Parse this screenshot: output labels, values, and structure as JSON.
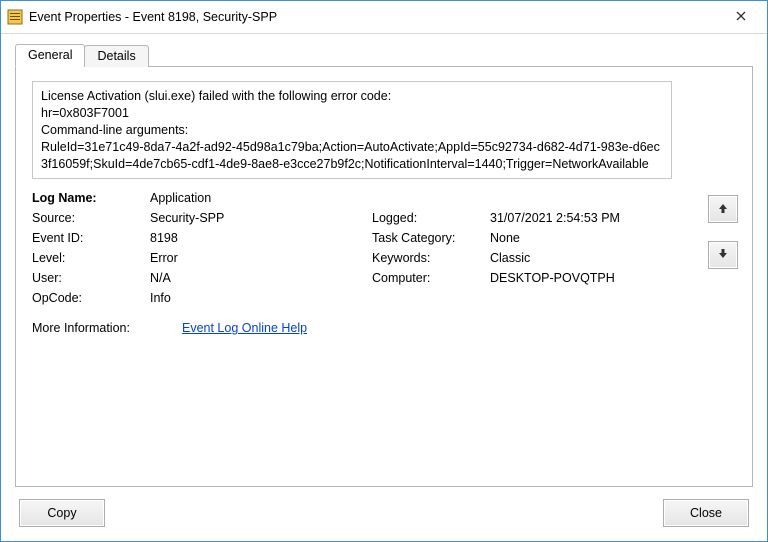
{
  "window": {
    "title": "Event Properties - Event 8198, Security-SPP"
  },
  "tabs": {
    "general": "General",
    "details": "Details"
  },
  "description": "License Activation (slui.exe) failed with the following error code:\nhr=0x803F7001\nCommand-line arguments:\nRuleId=31e71c49-8da7-4a2f-ad92-45d98a1c79ba;Action=AutoActivate;AppId=55c92734-d682-4d71-983e-d6ec3f16059f;SkuId=4de7cb65-cdf1-4de9-8ae8-e3cce27b9f2c;NotificationInterval=1440;Trigger=NetworkAvailable",
  "labels": {
    "log_name": "Log Name:",
    "source": "Source:",
    "event_id": "Event ID:",
    "level": "Level:",
    "user": "User:",
    "opcode": "OpCode:",
    "logged": "Logged:",
    "task_category": "Task Category:",
    "keywords": "Keywords:",
    "computer": "Computer:",
    "more_info": "More Information:"
  },
  "values": {
    "log_name": "Application",
    "source": "Security-SPP",
    "event_id": "8198",
    "level": "Error",
    "user": "N/A",
    "opcode": "Info",
    "logged": "31/07/2021 2:54:53 PM",
    "task_category": "None",
    "keywords": "Classic",
    "computer": "DESKTOP-POVQTPH",
    "more_info_link": "Event Log Online Help"
  },
  "buttons": {
    "copy": "Copy",
    "close": "Close"
  }
}
